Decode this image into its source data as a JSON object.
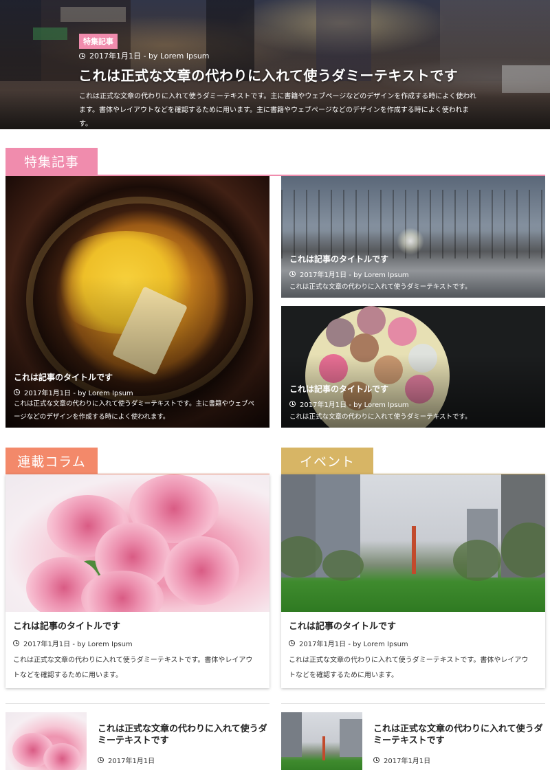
{
  "hero": {
    "tag": "特集記事",
    "meta": "2017年1月1日 - by Lorem Ipsum",
    "title": "これは正式な文章の代わりに入れて使うダミーテキストです",
    "excerpt": "これは正式な文章の代わりに入れて使うダミーテキストです。主に書籍やウェブページなどのデザインを作成する時によく使われます。書体やレイアウトなどを確認するために用います。主に書籍やウェブページなどのデザインを作成する時によく使われます。"
  },
  "featured": {
    "heading": "特集記事",
    "main": {
      "title": "これは記事のタイトルです",
      "meta": "2017年1月1日 - by Lorem Ipsum",
      "excerpt": "これは正式な文章の代わりに入れて使うダミーテキストです。主に書籍やウェブページなどのデザインを作成する時によく使われます。"
    },
    "side": [
      {
        "title": "これは記事のタイトルです",
        "meta": "2017年1月1日 - by Lorem Ipsum",
        "excerpt": "これは正式な文章の代わりに入れて使うダミーテキストです。"
      },
      {
        "title": "これは記事のタイトルです",
        "meta": "2017年1月1日 - by Lorem Ipsum",
        "excerpt": "これは正式な文章の代わりに入れて使うダミーテキストです。"
      }
    ]
  },
  "columns": [
    {
      "heading": "連載コラム",
      "title": "これは記事のタイトルです",
      "meta": "2017年1月1日 - by Lorem Ipsum",
      "excerpt": "これは正式な文章の代わりに入れて使うダミーテキストです。書体やレイアウトなどを確認するために用います。"
    },
    {
      "heading": "イベント",
      "title": "これは記事のタイトルです",
      "meta": "2017年1月1日 - by Lorem Ipsum",
      "excerpt": "これは正式な文章の代わりに入れて使うダミーテキストです。書体やレイアウトなどを確認するために用います。"
    }
  ],
  "list": [
    {
      "title": "これは正式な文章の代わりに入れて使うダミーテキストです",
      "date": "2017年1月1日"
    },
    {
      "title": "これは正式な文章の代わりに入れて使うダミーテキストです",
      "date": "2017年1月1日"
    }
  ],
  "colors": {
    "featured": "#f08cad",
    "column": "#f3896a",
    "event": "#d7b565"
  }
}
